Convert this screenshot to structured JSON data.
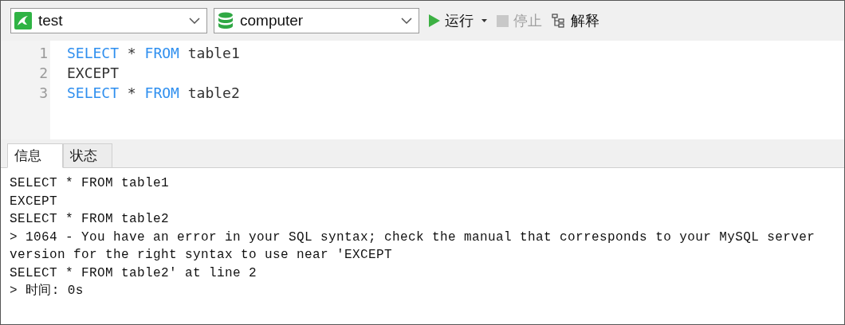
{
  "toolbar": {
    "connection": {
      "value": "test"
    },
    "database": {
      "value": "computer"
    },
    "buttons": [
      {
        "kind": "run",
        "label": "运行",
        "disabled": false
      },
      {
        "kind": "stop",
        "label": "停止",
        "disabled": true
      },
      {
        "kind": "explain",
        "label": "解释",
        "disabled": false
      }
    ]
  },
  "editor": {
    "lines": [
      {
        "number": "1",
        "tokens": [
          {
            "kind": "keyword",
            "text": "SELECT"
          },
          {
            "kind": "plain",
            "text": " * "
          },
          {
            "kind": "keyword",
            "text": "FROM"
          },
          {
            "kind": "plain",
            "text": " table1"
          }
        ]
      },
      {
        "number": "2",
        "tokens": [
          {
            "kind": "plain",
            "text": "EXCEPT"
          }
        ]
      },
      {
        "number": "3",
        "tokens": [
          {
            "kind": "keyword",
            "text": "SELECT"
          },
          {
            "kind": "plain",
            "text": " * "
          },
          {
            "kind": "keyword",
            "text": "FROM"
          },
          {
            "kind": "plain",
            "text": " table2"
          }
        ]
      }
    ]
  },
  "tabs": [
    {
      "label": "信息",
      "selected": true
    },
    {
      "label": "状态",
      "selected": false
    }
  ],
  "output": {
    "lines": [
      "SELECT * FROM table1",
      "EXCEPT",
      "SELECT * FROM table2",
      "> 1064 - You have an error in your SQL syntax; check the manual that corresponds to your MySQL server",
      "version for the right syntax to use near 'EXCEPT",
      "SELECT * FROM table2' at line 2",
      "> 时间: 0s"
    ]
  }
}
